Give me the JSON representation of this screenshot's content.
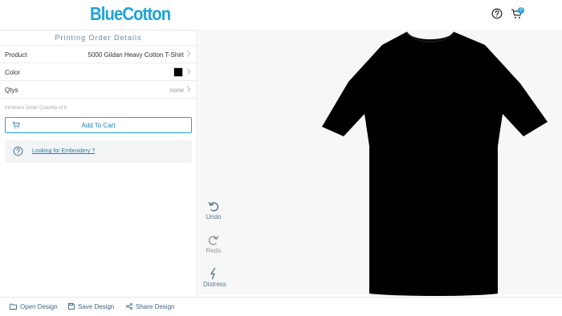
{
  "header": {
    "logo_text": "BlueCotton",
    "cart_count": "0",
    "icons": {
      "help": "help-circle-icon",
      "cart": "cart-icon"
    }
  },
  "order_panel": {
    "title": "Printing Order Details",
    "rows": [
      {
        "label": "Product",
        "value": "5000 Gildan Heavy Cotton T-Shirt"
      },
      {
        "label": "Color",
        "swatch_color": "#000000"
      },
      {
        "label": "Qtys",
        "value": "none"
      }
    ],
    "min_qty_note": "Minimum Order Quantity of 6",
    "add_to_cart_label": "Add To Cart",
    "embroidery_link": "Looking for Embroidery ?"
  },
  "tools": {
    "undo_label": "Undo",
    "redo_label": "Redo",
    "distress_label": "Distress"
  },
  "canvas": {
    "garment_color": "#000000",
    "background_color": "#f7f7f7"
  },
  "footer": {
    "open_label": "Open Design",
    "save_label": "Save Design",
    "share_label": "Share Design"
  },
  "colors": {
    "accent": "#1fa3d8",
    "link": "#1f7fb8"
  }
}
